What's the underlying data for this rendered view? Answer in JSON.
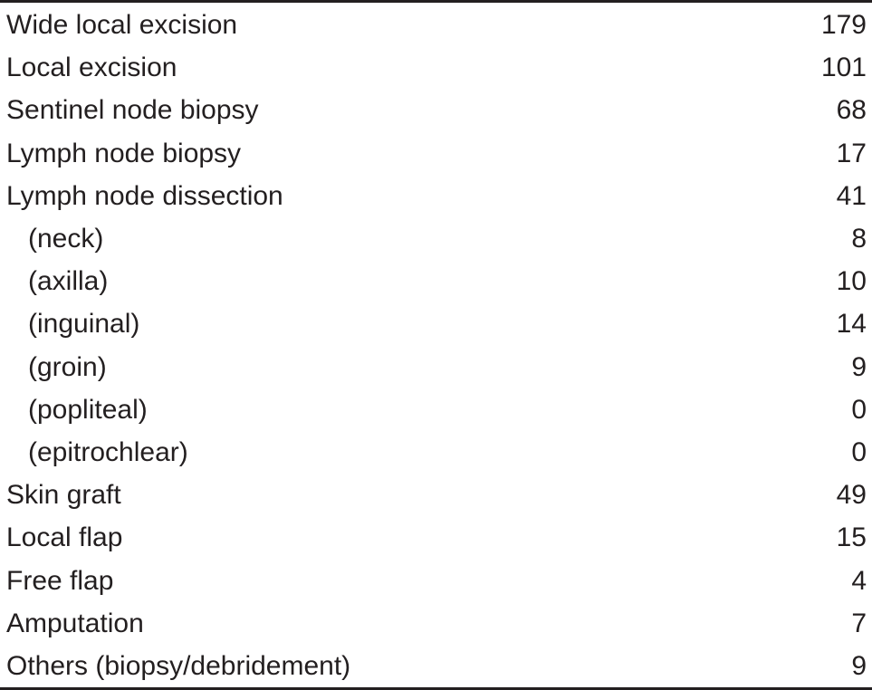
{
  "table": {
    "rows": [
      {
        "label": "Wide local excision",
        "value": "179",
        "indent": false
      },
      {
        "label": "Local excision",
        "value": "101",
        "indent": false
      },
      {
        "label": "Sentinel node biopsy",
        "value": "68",
        "indent": false
      },
      {
        "label": "Lymph node biopsy",
        "value": "17",
        "indent": false
      },
      {
        "label": "Lymph node dissection",
        "value": "41",
        "indent": false
      },
      {
        "label": "(neck)",
        "value": "8",
        "indent": true
      },
      {
        "label": "(axilla)",
        "value": "10",
        "indent": true
      },
      {
        "label": "(inguinal)",
        "value": "14",
        "indent": true
      },
      {
        "label": "(groin)",
        "value": "9",
        "indent": true
      },
      {
        "label": "(popliteal)",
        "value": "0",
        "indent": true
      },
      {
        "label": "(epitrochlear)",
        "value": "0",
        "indent": true
      },
      {
        "label": "Skin graft",
        "value": "49",
        "indent": false
      },
      {
        "label": "Local flap",
        "value": "15",
        "indent": false
      },
      {
        "label": "Free flap",
        "value": "4",
        "indent": false
      },
      {
        "label": "Amputation",
        "value": "7",
        "indent": false
      },
      {
        "label": "Others (biopsy/debridement)",
        "value": "9",
        "indent": false
      }
    ]
  }
}
